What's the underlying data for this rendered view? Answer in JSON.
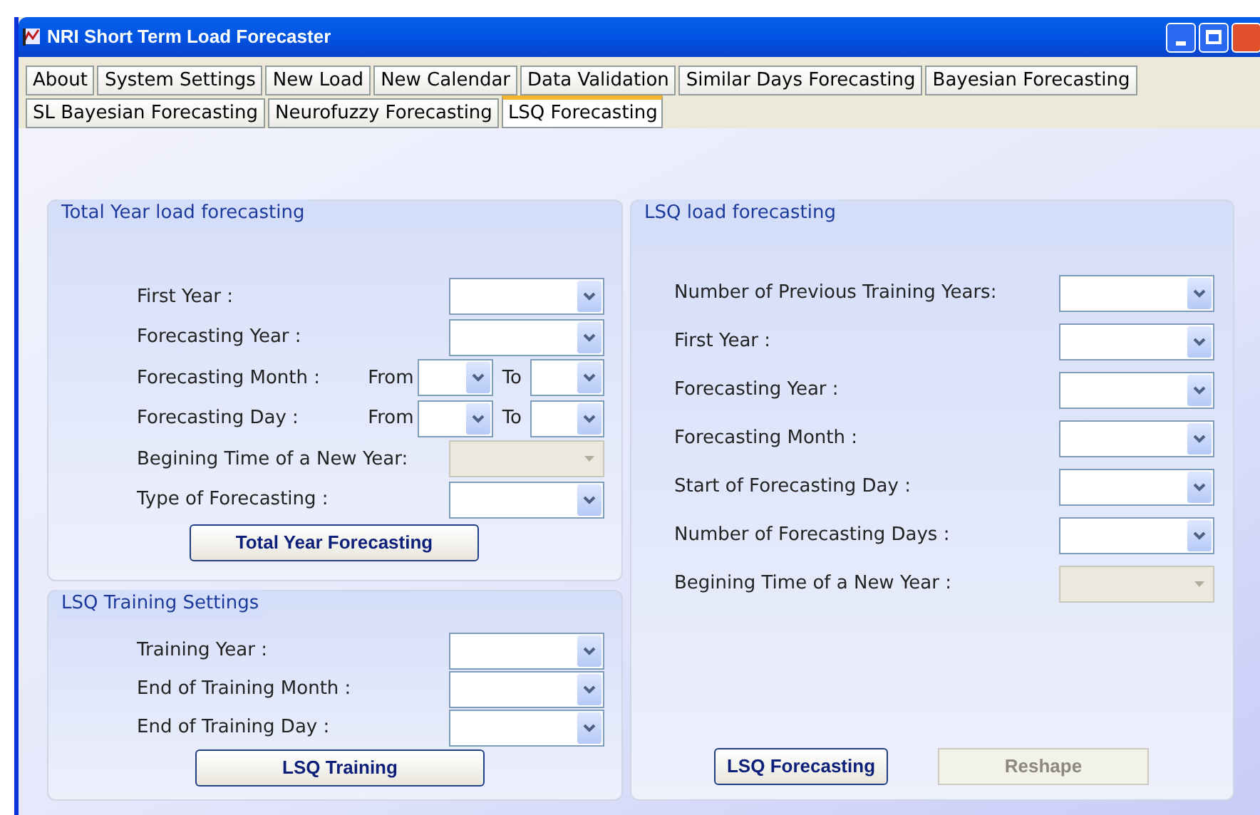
{
  "window": {
    "title": "NRI Short Term Load Forecaster"
  },
  "tab_rows": [
    [
      {
        "label": "About",
        "selected": false
      },
      {
        "label": "System Settings",
        "selected": false
      },
      {
        "label": "New Load",
        "selected": false
      },
      {
        "label": "New Calendar",
        "selected": false
      },
      {
        "label": "Data Validation",
        "selected": false
      },
      {
        "label": "Similar Days Forecasting",
        "selected": false
      },
      {
        "label": "Bayesian Forecasting",
        "selected": false
      }
    ],
    [
      {
        "label": "SL Bayesian Forecasting",
        "selected": false
      },
      {
        "label": "Neurofuzzy Forecasting",
        "selected": false
      },
      {
        "label": "LSQ Forecasting",
        "selected": true
      }
    ]
  ],
  "total_year_group": {
    "title": "Total Year load forecasting",
    "rows": [
      {
        "kind": "combo",
        "label": "First Year :",
        "disabled": false
      },
      {
        "kind": "combo",
        "label": "Forecasting Year :",
        "disabled": false
      },
      {
        "kind": "range",
        "label": "Forecasting Month :",
        "from_label": "From",
        "to_label": "To"
      },
      {
        "kind": "range",
        "label": "Forecasting Day :",
        "from_label": "From",
        "to_label": "To"
      },
      {
        "kind": "combo",
        "label": "Begining Time of a New Year:",
        "disabled": true
      },
      {
        "kind": "combo",
        "label": "Type of Forecasting :",
        "disabled": false
      }
    ],
    "button": {
      "label": "Total Year Forecasting",
      "disabled": false
    }
  },
  "training_group": {
    "title": "LSQ Training Settings",
    "rows": [
      {
        "kind": "combo",
        "label": "Training Year :",
        "disabled": false
      },
      {
        "kind": "combo",
        "label": "End of Training Month :",
        "disabled": false
      },
      {
        "kind": "combo",
        "label": "End of Training Day :",
        "disabled": false
      }
    ],
    "button": {
      "label": "LSQ Training",
      "disabled": false
    }
  },
  "lsq_group": {
    "title": "LSQ load forecasting",
    "rows": [
      {
        "kind": "combo",
        "label": "Number of Previous Training Years:",
        "disabled": false
      },
      {
        "kind": "combo",
        "label": "First Year :",
        "disabled": false
      },
      {
        "kind": "combo",
        "label": "Forecasting Year :",
        "disabled": false
      },
      {
        "kind": "combo",
        "label": "Forecasting Month :",
        "disabled": false
      },
      {
        "kind": "combo",
        "label": "Start of Forecasting Day :",
        "disabled": false
      },
      {
        "kind": "combo",
        "label": "Number of Forecasting Days :",
        "disabled": false
      },
      {
        "kind": "combo",
        "label": "Begining Time of a New Year :",
        "disabled": true
      }
    ],
    "buttons": [
      {
        "label": "LSQ Forecasting",
        "disabled": false
      },
      {
        "label": "Reshape",
        "disabled": true
      }
    ]
  }
}
